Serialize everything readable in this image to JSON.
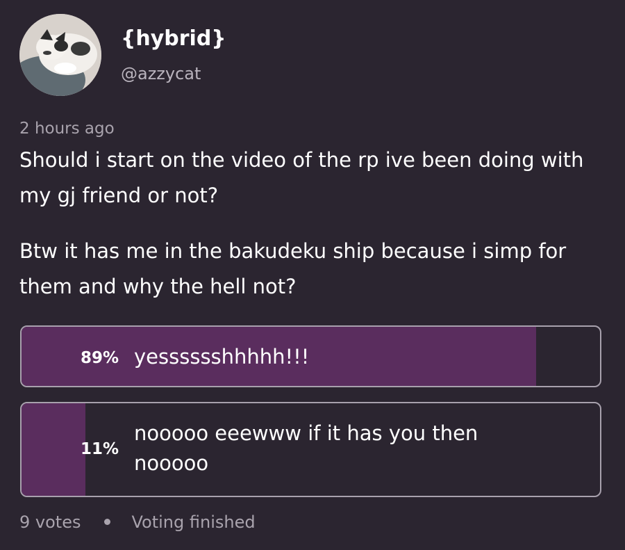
{
  "author": {
    "display_name": "{hybrid}",
    "username": "@azzycat"
  },
  "post": {
    "timestamp": "2 hours ago",
    "paragraphs": [
      "Should i start on the video of the rp ive been doing with my gj friend or not?",
      "Btw it has me in the bakudeku ship because i simp for them and why the hell not?"
    ]
  },
  "poll": {
    "options": [
      {
        "percent_label": "89%",
        "percent": 89,
        "label": "yesssssshhhhh!!!"
      },
      {
        "percent_label": "11%",
        "percent": 11,
        "label": "nooooo eeewww if it has you then nooooo"
      }
    ],
    "votes": "9 votes",
    "status": "Voting finished"
  },
  "colors": {
    "background": "#2b2530",
    "poll_fill": "#5a2d5e",
    "poll_border": "#a8a1ad",
    "muted_text": "#a9a3ad"
  }
}
